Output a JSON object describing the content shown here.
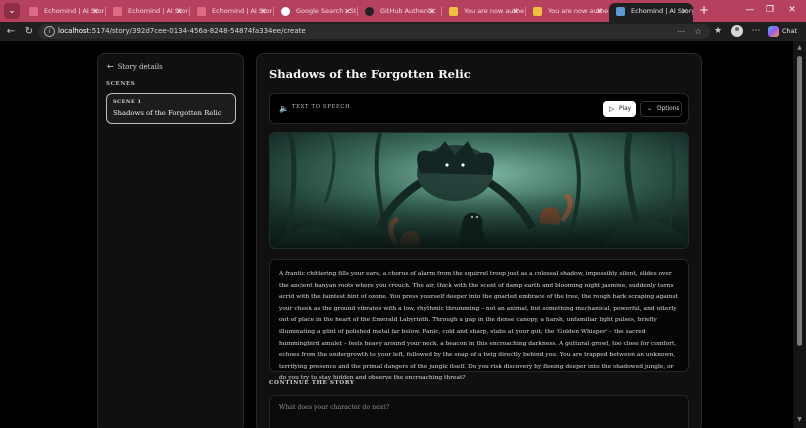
{
  "browser": {
    "tabs": [
      {
        "label": "Echomind | AI Story",
        "active": false
      },
      {
        "label": "Echomind | AI Story",
        "active": false
      },
      {
        "label": "Echomind | AI Story",
        "active": false
      },
      {
        "label": "Google Search - St",
        "active": false
      },
      {
        "label": "GitHub Authentic",
        "active": false
      },
      {
        "label": "You are now authe",
        "active": false
      },
      {
        "label": "You are now authe",
        "active": false
      },
      {
        "label": "Echomind | AI Story",
        "active": true
      }
    ],
    "url_host": "localhost",
    "url_path": ":5174/story/392d7cee-0134-456a-8248-54874fa334ee/create",
    "chat_label": "Chat",
    "colors": {
      "tab_bar": "#b5415f",
      "toolbar": "#1f1f1f"
    }
  },
  "sidebar": {
    "back_label": "Story details",
    "scenes_heading": "SCENES",
    "scenes": [
      {
        "number_label": "SCENE 1",
        "title": "Shadows of the Forgotten Relic"
      }
    ]
  },
  "main": {
    "title": "Shadows of the Forgotten Relic",
    "tts": {
      "label": "TEXT TO SPEECH",
      "play_label": "Play",
      "options_label": "Options"
    },
    "narrative": "A frantic chittering fills your ears, a chorus of alarm from the squirrel troop just as a colossal shadow, impossibly silent, slides over the ancient banyan roots where you crouch. The air, thick with the scent of damp earth and blooming night jasmine, suddenly turns acrid with the faintest hint of ozone. You press yourself deeper into the gnarled embrace of the tree, the rough bark scraping against your cheek as the ground vibrates with a low, rhythmic thrumming – not an animal, but something mechanical, powerful, and utterly out of place in the heart of the Emerald Labyrinth. Through a gap in the dense canopy, a harsh, unfamiliar light pulses, briefly illuminating a glint of polished metal far below. Panic, cold and sharp, stabs at your gut; the 'Golden Whisper' – the sacred hummingbird amulet – feels heavy around your neck, a beacon in this encroaching darkness. A guttural growl, too close for comfort, echoes from the undergrowth to your left, followed by the snap of a twig directly behind you. You are trapped between an unknown, terrifying presence and the primal dangers of the jungle itself. Do you risk discovery by fleeing deeper into the shadowed jungle, or do you try to stay hidden and observe the encroaching threat?",
    "continue_heading": "CONTINUE THE STORY",
    "prompt_placeholder": "What does your character do next?"
  }
}
